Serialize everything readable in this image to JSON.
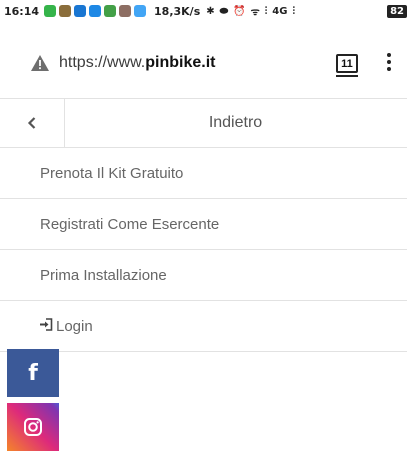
{
  "status_bar": {
    "time": "16:14",
    "net_speed": "18,3K/s",
    "network": "4G",
    "battery": "82",
    "app_icon_colors": [
      "#35b44a",
      "#8a6d3b",
      "#1976d2",
      "#1e88e5",
      "#43a047",
      "#8d6e63",
      "#42a5f5"
    ]
  },
  "browser": {
    "url_prefix": "https://www.",
    "url_domain": "pinbike.it",
    "tab_count": "11"
  },
  "menu": {
    "back_label": "Indietro",
    "items": [
      {
        "label": "Prenota Il Kit Gratuito"
      },
      {
        "label": "Registrati Come Esercente"
      },
      {
        "label": "Prima Installazione"
      }
    ],
    "login_label": "Login"
  },
  "social": {
    "facebook_glyph": "f",
    "facebook_color": "#3b5998"
  }
}
